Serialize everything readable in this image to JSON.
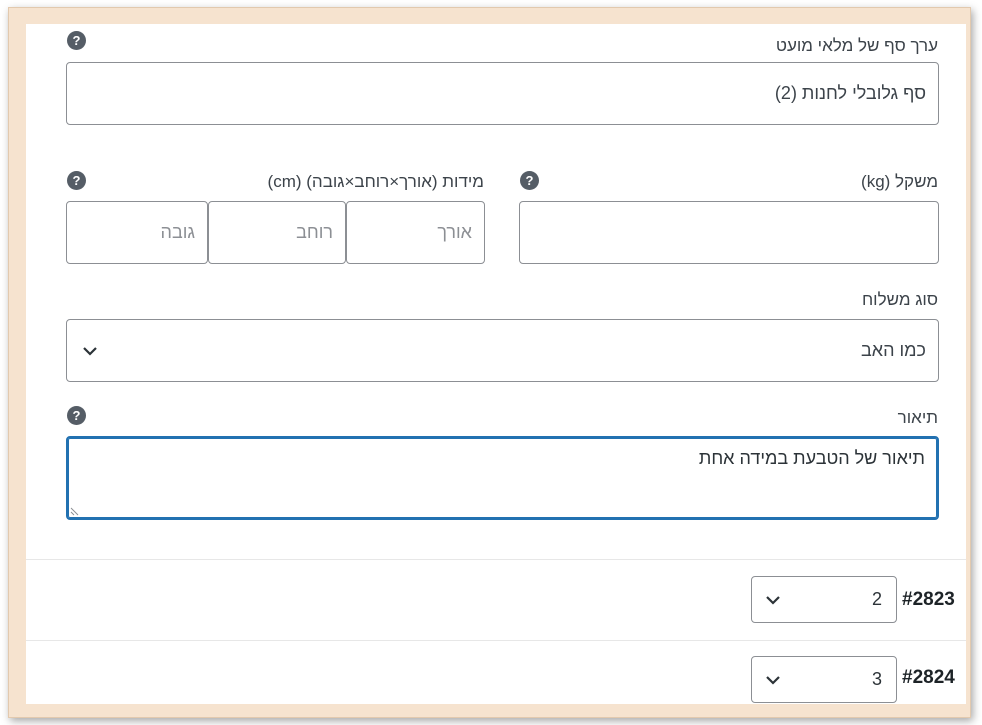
{
  "min_amount": {
    "label": "ערך סף של מלאי מועט",
    "value": "סף גלובלי לחנות (2)"
  },
  "weight": {
    "label": "משקל (kg)",
    "value": ""
  },
  "dimensions": {
    "label": "מידות (אורך×רוחב×גובה) (cm)",
    "length_placeholder": "אורך",
    "width_placeholder": "רוחב",
    "height_placeholder": "גובה"
  },
  "shipping_class": {
    "label": "סוג משלוח",
    "selected": "כמו האב"
  },
  "description": {
    "label": "תיאור",
    "value": "תיאור של הטבעת במידה אחת"
  },
  "help_icon_glyph": "?",
  "variations": [
    {
      "id": "#2823",
      "value": "2"
    },
    {
      "id": "#2824",
      "value": "3"
    }
  ],
  "colors": {
    "frame": "#f6e3cf",
    "focus": "#2271b1",
    "border": "#8c8f94",
    "help_icon": "#555d66"
  }
}
